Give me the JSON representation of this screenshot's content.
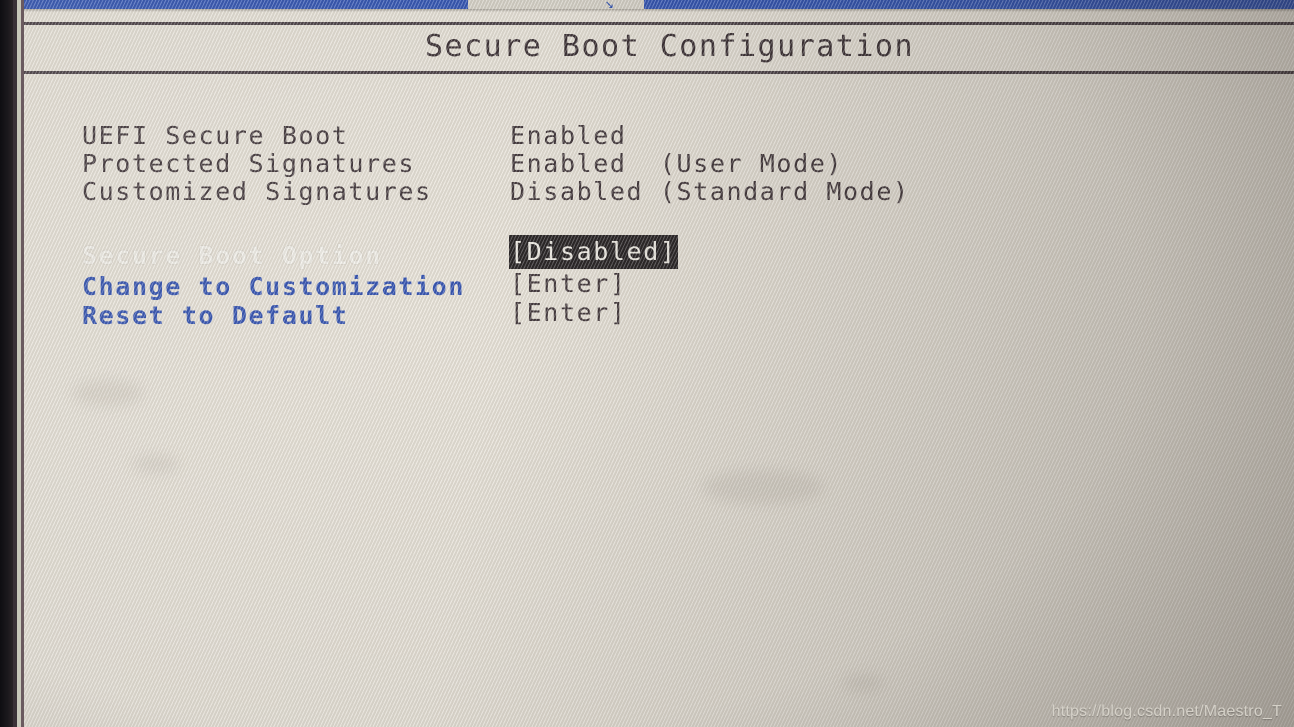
{
  "screen": {
    "title": "Secure Boot Configuration",
    "background_color": "#e9e4da",
    "text_color": "#3a2f34",
    "accent_blue": "#2b4cb0",
    "highlight_bg": "#1e1a1c",
    "highlight_fg": "#f2efe8",
    "topbar_color": "#2a4fb4"
  },
  "status_rows": [
    {
      "label": "UEFI Secure Boot",
      "value": "Enabled"
    },
    {
      "label": "Protected Signatures",
      "value": "Enabled  (User Mode)"
    },
    {
      "label": "Customized Signatures",
      "value": "Disabled (Standard Mode)"
    }
  ],
  "menu_rows": [
    {
      "label": "Secure Boot Option",
      "value": "[Disabled]",
      "selected": true,
      "value_highlighted": true
    },
    {
      "label": "Change to Customization",
      "value": "[Enter]",
      "selected": false,
      "value_highlighted": false
    },
    {
      "label": "Reset to Default",
      "value": "[Enter]",
      "selected": false,
      "value_highlighted": false
    }
  ],
  "watermark": {
    "text": "https://blog.csdn.net/Maestro_T"
  }
}
